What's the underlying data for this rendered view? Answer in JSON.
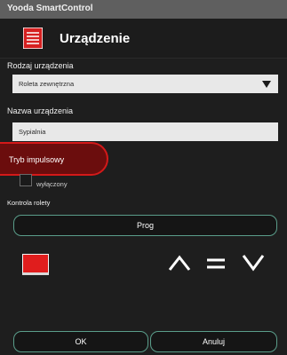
{
  "titlebar": {
    "title": "Yooda SmartControl"
  },
  "header": {
    "title": "Urządzenie",
    "icon": "device-list-icon"
  },
  "device_type": {
    "label": "Rodzaj urządzenia",
    "value": "Roleta zewnętrzna"
  },
  "device_name": {
    "label": "Nazwa urządzenia",
    "value": "Sypialnia"
  },
  "pulse_mode": {
    "label": "Tryb impulsowy",
    "checkbox_label": "wyłączony",
    "checked": false
  },
  "blind_control": {
    "label": "Kontrola rolety",
    "prog_label": "Prog",
    "controls": [
      "up-icon",
      "stop-icon",
      "down-icon"
    ]
  },
  "footer": {
    "ok_label": "OK",
    "cancel_label": "Anuluj"
  },
  "colors": {
    "accent": "#5a9d8a",
    "highlight": "#d41919",
    "device_red": "#e01d1d"
  }
}
